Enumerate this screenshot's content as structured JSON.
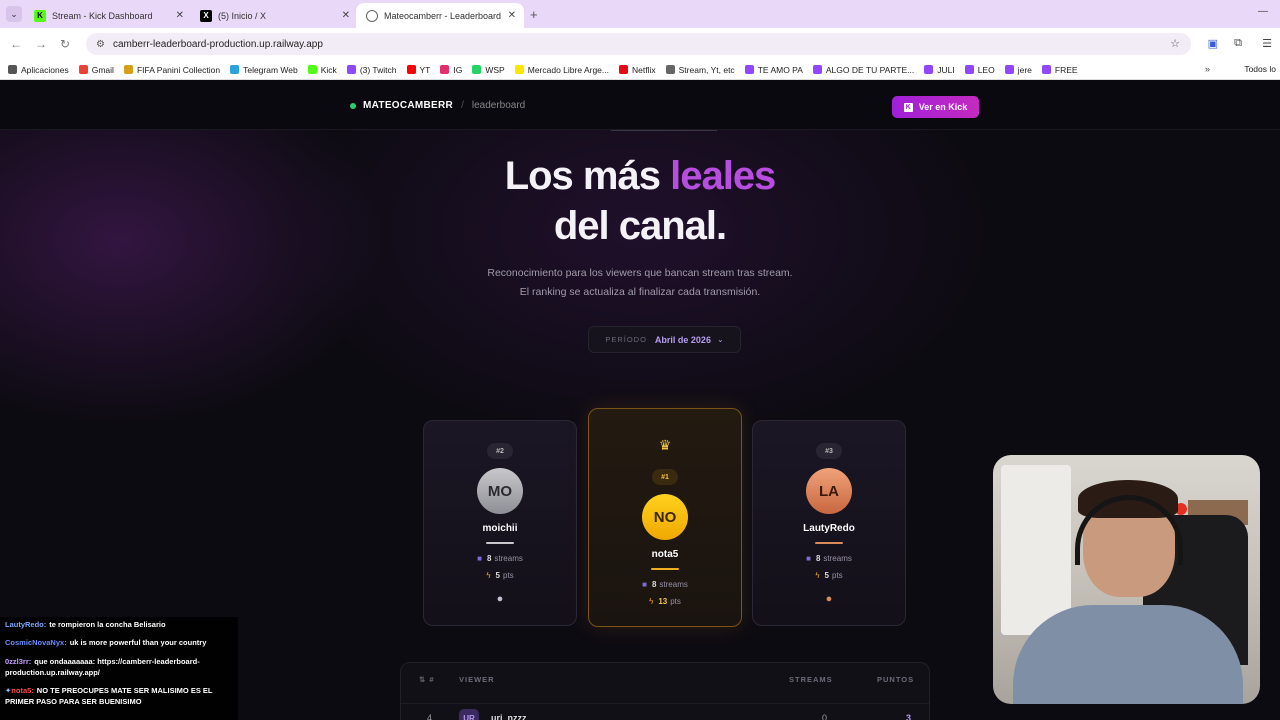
{
  "browser": {
    "tabs": [
      {
        "title": "Stream - Kick Dashboard",
        "favicon": "kick-icon",
        "color": "#53fc18",
        "active": false
      },
      {
        "title": "(5) Inicio / X",
        "favicon": "x-icon",
        "color": "#000000",
        "active": false
      },
      {
        "title": "Mateocamberr - Leaderboard",
        "favicon": "globe-icon",
        "color": "#444444",
        "active": true
      }
    ],
    "new_tab": "+",
    "url": "camberr-leaderboard-production.up.railway.app",
    "bookmarks": [
      {
        "label": "Aplicaciones",
        "color": "#555555"
      },
      {
        "label": "Gmail",
        "color": "#ea4335"
      },
      {
        "label": "FIFA Panini Collection",
        "color": "#d4a017"
      },
      {
        "label": "Telegram Web",
        "color": "#2aa3df"
      },
      {
        "label": "Kick",
        "color": "#53fc18"
      },
      {
        "label": "(3) Twitch",
        "color": "#9146ff"
      },
      {
        "label": "YT",
        "color": "#ff0000"
      },
      {
        "label": "IG",
        "color": "#e1306c"
      },
      {
        "label": "WSP",
        "color": "#25d366"
      },
      {
        "label": "Mercado Libre Arge...",
        "color": "#ffe600"
      },
      {
        "label": "Netflix",
        "color": "#e50914"
      },
      {
        "label": "Stream, Yt, etc",
        "color": "#666666"
      },
      {
        "label": "TE AMO PA",
        "color": "#9146ff"
      },
      {
        "label": "ALGO DE TU PARTE...",
        "color": "#9146ff"
      },
      {
        "label": "JULI",
        "color": "#9146ff"
      },
      {
        "label": "LEO",
        "color": "#9146ff"
      },
      {
        "label": "jere",
        "color": "#9146ff"
      },
      {
        "label": "FREE",
        "color": "#9146ff"
      }
    ],
    "bookmarks_more": "»",
    "bookmarks_all": "Todos lo"
  },
  "site": {
    "brand": "MATEOCAMBERR",
    "separator": "/",
    "crumb": "leaderboard",
    "kick_button": "Ver en Kick",
    "kick_logo": "K",
    "title_part1": "Los más ",
    "title_accent": "leales",
    "title_line2": "del canal.",
    "subtitle_1": "Reconocimiento para los viewers que bancan stream tras stream.",
    "subtitle_2": "El ranking se actualiza al finalizar cada transmisión.",
    "period_label": "PERÍODO",
    "period_value": "Abril de 2026",
    "accent_color": "#b84ee0"
  },
  "podium": {
    "second": {
      "rank": "#2",
      "initials": "MO",
      "name": "moichii",
      "streams": "8",
      "streams_label": "streams",
      "points": "5",
      "points_label": "pts",
      "medal": "silver-medal-icon"
    },
    "first": {
      "rank": "#1",
      "initials": "NO",
      "name": "nota5",
      "streams": "8",
      "streams_label": "streams",
      "points": "13",
      "points_label": "pts",
      "crown": "crown-icon"
    },
    "third": {
      "rank": "#3",
      "initials": "LA",
      "name": "LautyRedo",
      "streams": "8",
      "streams_label": "streams",
      "points": "5",
      "points_label": "pts",
      "medal": "bronze-medal-icon"
    }
  },
  "table": {
    "headers": {
      "rank": "#",
      "viewer": "VIEWER",
      "streams": "STREAMS",
      "points": "PUNTOS"
    },
    "rows": [
      {
        "rank": "4",
        "initials": "UR",
        "name": "uri_nzzz",
        "streams": "0",
        "points": "3"
      }
    ]
  },
  "chat": [
    {
      "user": "LautyRedo:",
      "color": "#7aa7ff",
      "text": "te rompieron la concha Belisario"
    },
    {
      "user": "CosmicNovaNyx:",
      "color": "#6a8cff",
      "text": "uk is more powerful than your country"
    },
    {
      "user": "0zzl3rr:",
      "color": "#c9a0ff",
      "text": "que ondaaaaaaa: https://camberr-leaderboard-production.up.railway.app/"
    },
    {
      "user": "nota5:",
      "color": "#ff4a4a",
      "text": "NO TE PREOCUPES MATE SER MALISIMO ES EL PRIMER PASO PARA SER BUENISIMO"
    }
  ]
}
